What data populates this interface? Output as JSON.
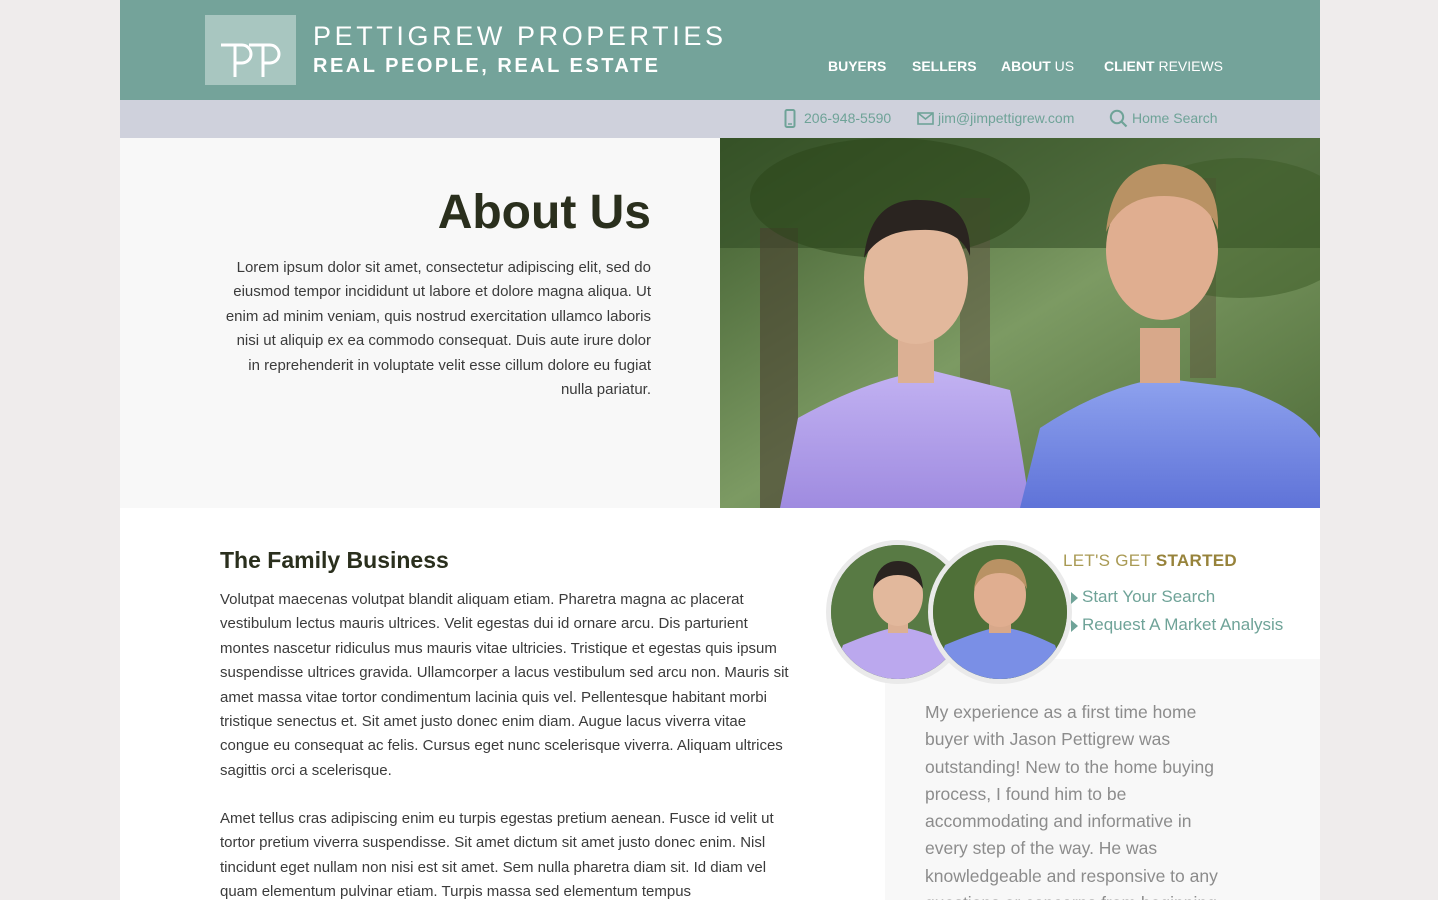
{
  "brand": {
    "name": "PETTIGREW PROPERTIES",
    "tagline": "REAL PEOPLE, REAL ESTATE"
  },
  "nav": {
    "buyers": "BUYERS",
    "sellers": "SELLERS",
    "about_bold": "ABOUT",
    "about_light": " US",
    "reviews_bold": "CLIENT",
    "reviews_light": " REVIEWS"
  },
  "contact": {
    "phone": "206-948-5590",
    "email": "jim@jimpettigrew.com",
    "search": "Home Search"
  },
  "hero": {
    "title": "About Us",
    "text": "Lorem ipsum dolor sit amet, consectetur adipiscing elit, sed do eiusmod tempor incididunt ut labore et dolore magna aliqua. Ut enim ad minim veniam, quis nostrud exercitation ullamco laboris nisi ut aliquip ex ea commodo consequat. Duis aute irure dolor in reprehenderit in voluptate velit esse cillum dolore eu fugiat nulla pariatur."
  },
  "family": {
    "title": "The Family Business",
    "para1": "Volutpat maecenas volutpat blandit aliquam etiam. Pharetra magna ac placerat vestibulum lectus mauris ultrices. Velit egestas dui id ornare arcu. Dis parturient montes nascetur ridiculus mus mauris vitae ultricies. Tristique et egestas quis ipsum suspendisse ultrices gravida. Ullamcorper a lacus vestibulum sed arcu non. Mauris sit amet massa vitae tortor condimentum lacinia quis vel. Pellentesque habitant morbi tristique senectus et. Sit amet justo donec enim diam. Augue lacus viverra vitae congue eu consequat ac felis. Cursus eget nunc scelerisque viverra. Aliquam ultrices sagittis orci a scelerisque.",
    "para2": "Amet tellus cras adipiscing enim eu turpis egestas pretium aenean. Fusce id velit ut tortor pretium viverra suspendisse. Sit amet dictum sit amet justo donec enim. Nisl tincidunt eget nullam non nisi est sit amet. Sem nulla pharetra diam sit. Id diam vel quam elementum pulvinar etiam. Turpis massa sed elementum tempus"
  },
  "get_started": {
    "title_light": "LET'S GET ",
    "title_bold": "STARTED",
    "link1": "Start Your Search",
    "link2": "Request A Market Analysis"
  },
  "testimonial": {
    "text": "My experience as a first time home buyer with Jason Pettigrew was outstanding! New to the home buying process, I found him to be accommodating and informative in every step of the way.  He was knowledgeable and responsive to any questions or concerns from beginning"
  },
  "colors": {
    "header": "#74a39a",
    "contact_bar": "#cfd1dc",
    "link": "#6fa398",
    "gold": "#97833b"
  }
}
